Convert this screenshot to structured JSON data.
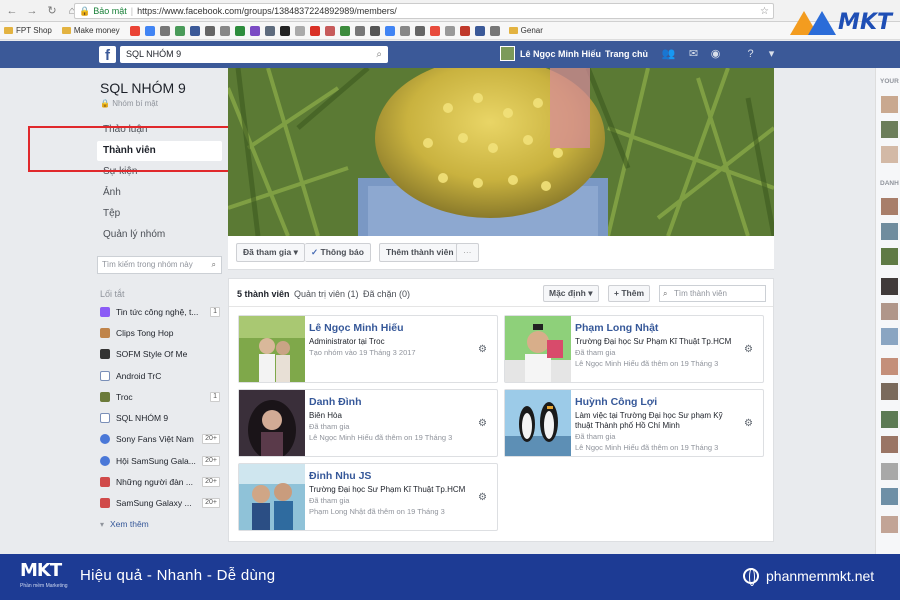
{
  "browser": {
    "secure_label": "Bảo mật",
    "url": "https://www.facebook.com/groups/1384837224892989/members/",
    "bookmarks": [
      "FPT Shop",
      "Make money"
    ],
    "bookmark_more": "Genar"
  },
  "brand": {
    "top_logo": "MKT"
  },
  "fb": {
    "search_value": "SQL NHÓM 9",
    "user_name": "Lê Ngọc Minh Hiếu",
    "home_label": "Trang chủ"
  },
  "group": {
    "name": "SQL NHÓM 9",
    "privacy": "Nhóm bí mật",
    "nav": [
      "Thảo luận",
      "Thành viên",
      "Sự kiện",
      "Ảnh",
      "Tệp",
      "Quản lý nhóm"
    ],
    "search_placeholder": "Tìm kiếm trong nhóm này",
    "shortcuts_label": "Lối tắt",
    "shortcuts": [
      {
        "label": "Tin tức công nghệ, t...",
        "count": "1",
        "color": "#8b5cf6"
      },
      {
        "label": "Clips Tong Hop",
        "count": "",
        "color": "#c0844a"
      },
      {
        "label": "SOFM Style Of Me",
        "count": "",
        "color": "#333333"
      },
      {
        "label": "Android TrC",
        "count": "",
        "color": "#7a8fb8"
      },
      {
        "label": "Troc",
        "count": "1",
        "color": "#6b7a3a"
      },
      {
        "label": "SQL NHÓM 9",
        "count": "",
        "color": "#7a8fb8"
      },
      {
        "label": "Sony Fans Việt Nam",
        "count": "20+",
        "color": "#4a78d8"
      },
      {
        "label": "Hội SamSung Gala...",
        "count": "20+",
        "color": "#4a78d8"
      },
      {
        "label": "Những người đàn ...",
        "count": "20+",
        "color": "#d04a4a"
      },
      {
        "label": "SamSung Galaxy ...",
        "count": "20+",
        "color": "#d04a4a"
      }
    ],
    "see_more": "Xem thêm"
  },
  "actions": {
    "joined": "Đã tham gia",
    "notifications": "Thông báo",
    "add_member": "Thêm thành viên",
    "more": "···"
  },
  "members": {
    "tabs": [
      "5 thành viên",
      "Quản trị viên (1)",
      "Đã chặn (0)"
    ],
    "sort_label": "Mặc định",
    "add_label": "Thêm",
    "search_placeholder": "Tìm thành viên",
    "cards": [
      {
        "name": "Lê Ngọc Minh Hiếu",
        "line1": "Administrator tại Troc",
        "line2": "Tạo nhóm vào 19 Tháng 3 2017",
        "line3": ""
      },
      {
        "name": "Phạm Long Nhật",
        "line1": "Trường Đại học Sư Phạm Kĩ Thuật Tp.HCM",
        "line2": "Đã tham gia",
        "line3": "Lê Ngọc Minh Hiếu đã thêm on 19 Tháng 3"
      },
      {
        "name": "Danh Đình",
        "line1": "Biên Hòa",
        "line2": "Đã tham gia",
        "line3": "Lê Ngọc Minh Hiếu đã thêm on 19 Tháng 3"
      },
      {
        "name": "Huỳnh Công Lợi",
        "line1": "Làm việc tại Trường Đại học Sư phạm Kỹ thuật Thành phố Hồ Chí Minh",
        "line2": "Đã tham gia",
        "line3": "Lê Ngọc Minh Hiếu đã thêm on 19 Tháng 3"
      },
      {
        "name": "Đinh Nhu JS",
        "line1": "Trường Đại học Sư Phạm Kĩ Thuật Tp.HCM",
        "line2": "Đã tham gia",
        "line3": "Phạm Long Nhật đã thêm on 19 Tháng 3"
      }
    ]
  },
  "right_rail": {
    "label1": "YOUR",
    "label2": "DANH"
  },
  "banner": {
    "logo": "MKT",
    "logo_sub": "Phần mềm Marketing",
    "slogan": "Hiệu quả - Nhanh  - Dễ dùng",
    "site": "phanmemmkt.net"
  }
}
